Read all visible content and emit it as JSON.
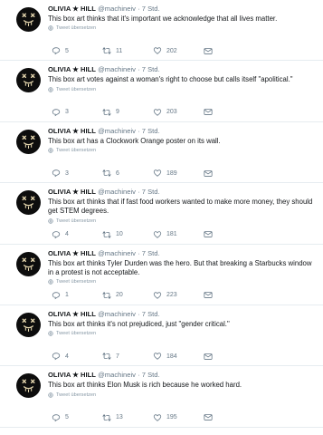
{
  "tweets": [
    {
      "name": "OLIVIA ★ HILL",
      "handle": "@machineiv",
      "time": "· 7 Std.",
      "text": "This box art thinks that it's important we acknowledge that all lives matter.",
      "translate": "Tweet übersetzen",
      "replies": "5",
      "retweets": "11",
      "likes": "202"
    },
    {
      "name": "OLIVIA ★ HILL",
      "handle": "@machineiv",
      "time": "· 7 Std.",
      "text": "This box art votes against a woman's right to choose but calls itself \"apolitical.\"",
      "translate": "Tweet übersetzen",
      "replies": "3",
      "retweets": "9",
      "likes": "203"
    },
    {
      "name": "OLIVIA ★ HILL",
      "handle": "@machineiv",
      "time": "· 7 Std.",
      "text": "This box art has a Clockwork Orange poster on its wall.",
      "translate": "Tweet übersetzen",
      "replies": "3",
      "retweets": "6",
      "likes": "189"
    },
    {
      "name": "OLIVIA ★ HILL",
      "handle": "@machineiv",
      "time": "· 7 Std.",
      "text": "This box art thinks that if fast food workers wanted to make more money, they should get STEM degrees.",
      "translate": "Tweet übersetzen",
      "replies": "4",
      "retweets": "10",
      "likes": "181"
    },
    {
      "name": "OLIVIA ★ HILL",
      "handle": "@machineiv",
      "time": "· 7 Std.",
      "text": "This box art thinks Tyler Durden was the hero. But that breaking a Starbucks window in a protest is not acceptable.",
      "translate": "Tweet übersetzen",
      "replies": "1",
      "retweets": "20",
      "likes": "223"
    },
    {
      "name": "OLIVIA ★ HILL",
      "handle": "@machineiv",
      "time": "· 7 Std.",
      "text": "This box art thinks it's not prejudiced, just \"gender critical.\"",
      "translate": "Tweet übersetzen",
      "replies": "4",
      "retweets": "7",
      "likes": "184"
    },
    {
      "name": "OLIVIA ★ HILL",
      "handle": "@machineiv",
      "time": "· 7 Std.",
      "text": "This box art thinks Elon Musk is rich because he worked hard.",
      "translate": "Tweet übersetzen",
      "replies": "5",
      "retweets": "13",
      "likes": "195"
    }
  ],
  "colors": {
    "text": "#14171a",
    "muted": "#657786",
    "divider": "#e6ecf0",
    "avatar": "#0d0d0d"
  },
  "icons": {
    "reply": "reply-icon",
    "retweet": "retweet-icon",
    "like": "heart-icon",
    "dm": "envelope-icon",
    "translate": "globe-icon",
    "avatar": "avatar-skull-icon"
  }
}
